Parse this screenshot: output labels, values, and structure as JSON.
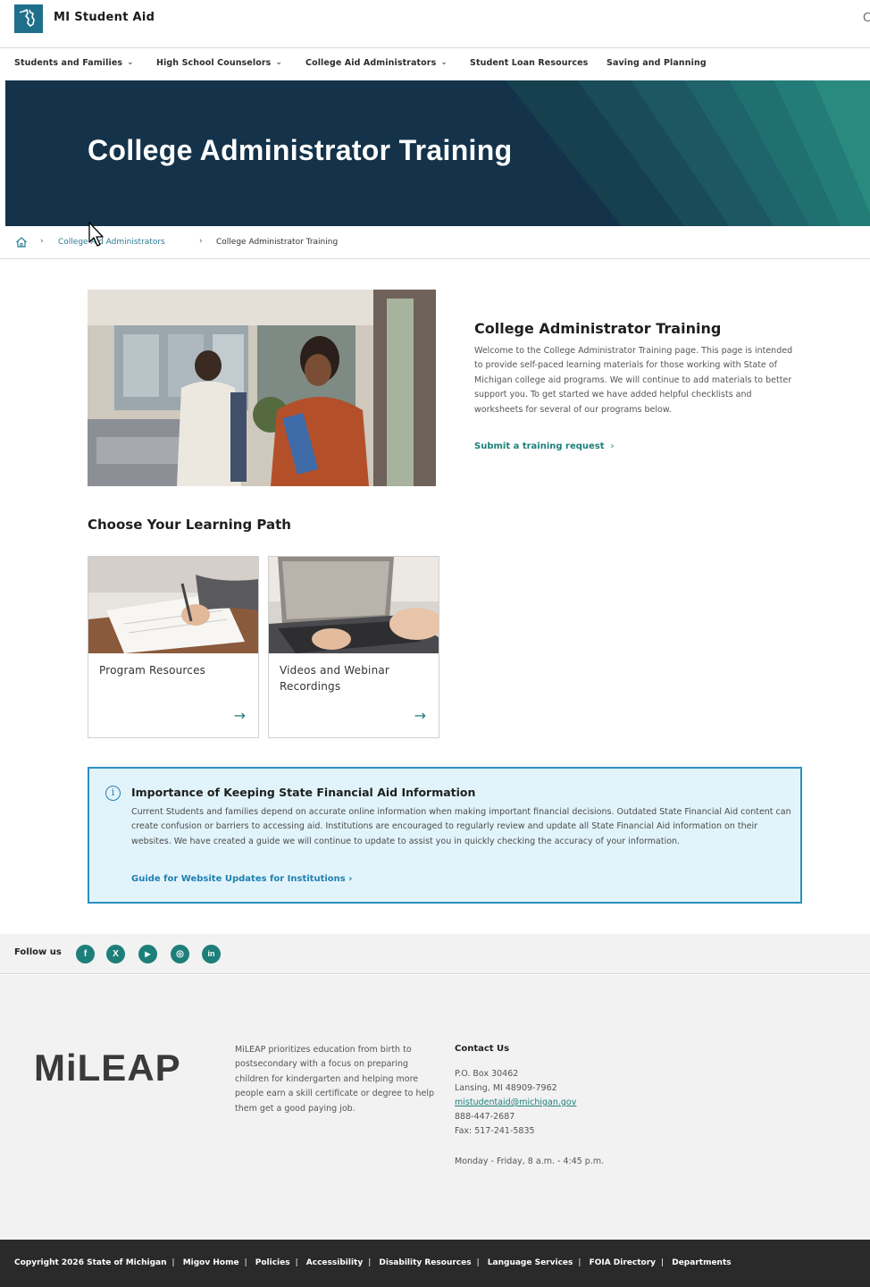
{
  "header": {
    "site_title": "MI Student Aid",
    "edge_glyph": "C"
  },
  "nav": {
    "items": [
      {
        "label": "Students and Families",
        "has_dropdown": true
      },
      {
        "label": "High School Counselors",
        "has_dropdown": true
      },
      {
        "label": "College Aid Administrators",
        "has_dropdown": true
      },
      {
        "label": "Student Loan Resources",
        "has_dropdown": false
      },
      {
        "label": "Saving and Planning",
        "has_dropdown": false
      }
    ],
    "dropdown_glyph": "⌄"
  },
  "hero": {
    "title": "College Administrator Training",
    "bg_color": "#14334a",
    "accent_color": "#1d7f7a"
  },
  "breadcrumb": {
    "home_icon": "home-icon",
    "separator": "›",
    "items": [
      {
        "label": "College Aid Administrators",
        "is_link": true
      },
      {
        "label": "College Administrator Training",
        "is_link": false
      }
    ]
  },
  "intro": {
    "heading": "College Administrator Training",
    "body": "Welcome to the College Administrator Training page. This page is intended to provide self-paced learning materials for those working with State of Michigan college aid programs. We will continue to add materials to better support you. To get started we have added helpful checklists and worksheets for several of our programs below.",
    "link_label": "Submit a training request",
    "link_arrow": "›"
  },
  "learning_path": {
    "heading": "Choose Your Learning Path",
    "arrow_glyph": "→",
    "cards": [
      {
        "label": "Program Resources",
        "image": "writing-notebook-image"
      },
      {
        "label": "Videos and Webinar Recordings",
        "image": "webinar-laptop-image"
      }
    ]
  },
  "notice": {
    "icon": "info-icon",
    "icon_glyph": "i",
    "title": "Importance of Keeping State Financial Aid Information",
    "body": "Current Students and families depend on accurate online information when making important financial decisions. Outdated State Financial Aid content can create confusion or barriers to accessing aid. Institutions are encouraged to regularly review and update all State Financial Aid information on their websites. We have created a guide we will continue to update to assist you in quickly checking the accuracy of your information.",
    "link_label": "Guide for Website Updates for Institutions ›",
    "border_color": "#2b8fc0",
    "bg_color": "#e2f4fb"
  },
  "social": {
    "label": "Follow us",
    "icons": [
      {
        "name": "facebook-icon",
        "glyph": "f"
      },
      {
        "name": "x-icon",
        "glyph": "X"
      },
      {
        "name": "youtube-icon",
        "glyph": "▶"
      },
      {
        "name": "instagram-icon",
        "glyph": "◎"
      },
      {
        "name": "linkedin-icon",
        "glyph": "in"
      }
    ]
  },
  "footer": {
    "logo_text": "MiLEAP",
    "blurb": "MiLEAP prioritizes education from birth to postsecondary with a focus on preparing children for kindergarten and helping more people earn a skill certificate or degree to help them get a good paying job.",
    "contact_title": "Contact Us",
    "po_box": "P.O. Box 30462",
    "city": "Lansing, MI 48909-7962",
    "email": "mistudentaid@michigan.gov",
    "phone": "888-447-2687",
    "fax": "Fax: 517-241-5835",
    "hours": "Monday - Friday, 8 a.m. - 4:45 p.m."
  },
  "bottom_bar": {
    "separator": "|",
    "links": [
      "Copyright 2026 State of Michigan",
      "Migov Home",
      "Policies",
      "Accessibility",
      "Disability Resources",
      "Language Services",
      "FOIA Directory",
      "Departments"
    ]
  }
}
